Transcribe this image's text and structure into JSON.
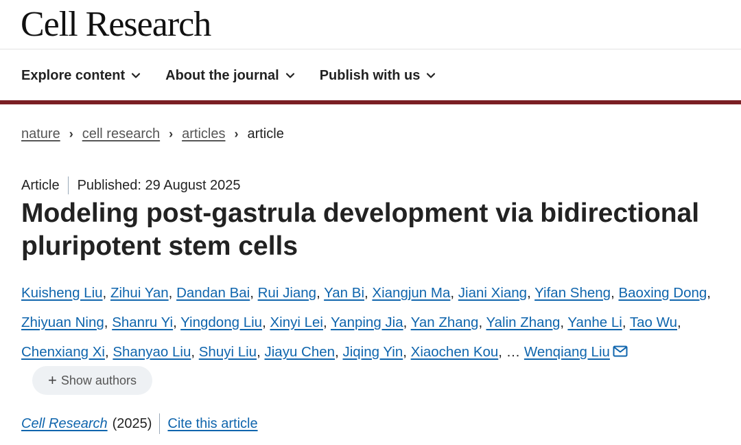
{
  "site": {
    "logo": "Cell Research"
  },
  "nav": {
    "items": [
      {
        "label": "Explore content",
        "icon": "chevron-down-icon"
      },
      {
        "label": "About the journal",
        "icon": "chevron-down-icon"
      },
      {
        "label": "Publish with us",
        "icon": "chevron-down-icon"
      }
    ]
  },
  "colors": {
    "accent_bar": "#7a1f24",
    "link": "#0f65ad"
  },
  "breadcrumb": {
    "items": [
      "nature",
      "cell research",
      "articles"
    ],
    "current": "article"
  },
  "article": {
    "type": "Article",
    "published": "Published: 29 August 2025",
    "title": "Modeling post-gastrula development via bidirectional pluripotent stem cells",
    "authors": [
      "Kuisheng Liu",
      "Zihui Yan",
      "Dandan Bai",
      "Rui Jiang",
      "Yan Bi",
      "Xiangjun Ma",
      "Jiani Xiang",
      "Yifan Sheng",
      "Baoxing Dong",
      "Zhiyuan Ning",
      "Shanru Yi",
      "Yingdong Liu",
      "Xinyi Lei",
      "Yanping Jia",
      "Yan Zhang",
      "Yalin Zhang",
      "Yanhe Li",
      "Tao Wu",
      "Chenxiang Xi",
      "Shanyao Liu",
      "Shuyi Liu",
      "Jiayu Chen",
      "Jiqing Yin",
      "Xiaochen Kou"
    ],
    "ellipsis": "…",
    "corresponding_author": "Wenqiang Liu",
    "show_authors_label": "Show authors",
    "journal": "Cell Research",
    "year": "(2025)",
    "cite_label": "Cite this article"
  }
}
